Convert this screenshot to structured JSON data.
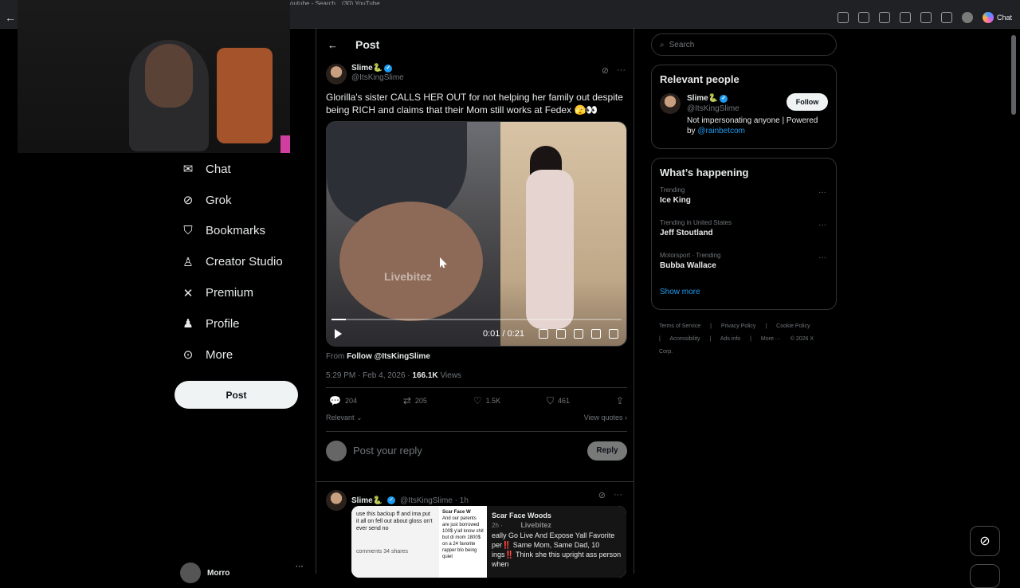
{
  "browser": {
    "tabs": [
      "youtube - Search",
      "(30) YouTube"
    ],
    "copilot_label": "Chat"
  },
  "nav": {
    "items": [
      {
        "label": "Chat",
        "icon": "mail-icon"
      },
      {
        "label": "Grok",
        "icon": "grok-icon"
      },
      {
        "label": "Bookmarks",
        "icon": "bookmark-icon"
      },
      {
        "label": "Creator Studio",
        "icon": "creator-icon"
      },
      {
        "label": "Premium",
        "icon": "x-logo-icon"
      },
      {
        "label": "Profile",
        "icon": "person-icon"
      },
      {
        "label": "More",
        "icon": "more-circle-icon"
      }
    ],
    "post_label": "Post",
    "account_name": "Morro"
  },
  "main": {
    "header_title": "Post",
    "tweet": {
      "display_name": "Slime🐍",
      "handle": "@ItsKingSlime",
      "text": "Glorilla's sister CALLS HER OUT for not helping her family out despite being RICH and claims that their Mom still works at Fedex 🫣👀",
      "video": {
        "watermark": "Livebitez",
        "time": "0:01 / 0:21",
        "progress": 0.05
      },
      "from_prefix": "From",
      "from_link": "Follow @ItsKingSlime",
      "timestamp": "5:29 PM · Feb 4, 2026 ·",
      "views_count": "166.1K",
      "views_label": "Views",
      "stats": {
        "replies": "204",
        "reposts": "205",
        "likes": "1.5K",
        "bookmarks": "461"
      },
      "sort_label": "Relevant",
      "view_quotes": "View quotes"
    },
    "reply_placeholder": "Post your reply",
    "reply_button": "Reply",
    "tweet2": {
      "display_name": "Slime🐍",
      "handle": "@ItsKingSlime · 1h",
      "shot1_text": "use this backup ff and ima put it all on fell out about gloss on't ever send no",
      "shot1_footer": "comments 34 shares",
      "shot2_name": "Scar Face W",
      "shot2_text": "And our parents are just borrowed 100$ y'all know shit but di mom 1800$ on a 24 favorite rapper blo being quiet",
      "shot3_name": "Scar Face Woods",
      "shot3_meta": "2h ·",
      "shot3_text": "eally Go Live And Expose Yall Favorite per‼️ Same Mom, Same Dad, 10 ings‼️ Think she this upright ass person when",
      "watermark": "Livebitez"
    }
  },
  "sidebar": {
    "search_placeholder": "Search",
    "relevant_people": {
      "title": "Relevant people",
      "display_name": "Slime🐍",
      "handle": "@ItsKingSlime",
      "bio": "Not impersonating anyone | Powered by",
      "bio_link": "@rainbetcom",
      "follow_label": "Follow"
    },
    "happening": {
      "title": "What’s happening",
      "trends": [
        {
          "context": "Trending",
          "name": "Ice King"
        },
        {
          "context": "Trending in United States",
          "name": "Jeff Stoutland"
        },
        {
          "context": "Motorsport · Trending",
          "name": "Bubba Wallace"
        }
      ],
      "show_more": "Show more"
    },
    "footer": [
      "Terms of Service",
      "|",
      "Privacy Policy",
      "|",
      "Cookie Policy",
      "|",
      "Accessibility",
      "|",
      "Ads info",
      "|",
      "More ···",
      "© 2026 X Corp."
    ]
  }
}
